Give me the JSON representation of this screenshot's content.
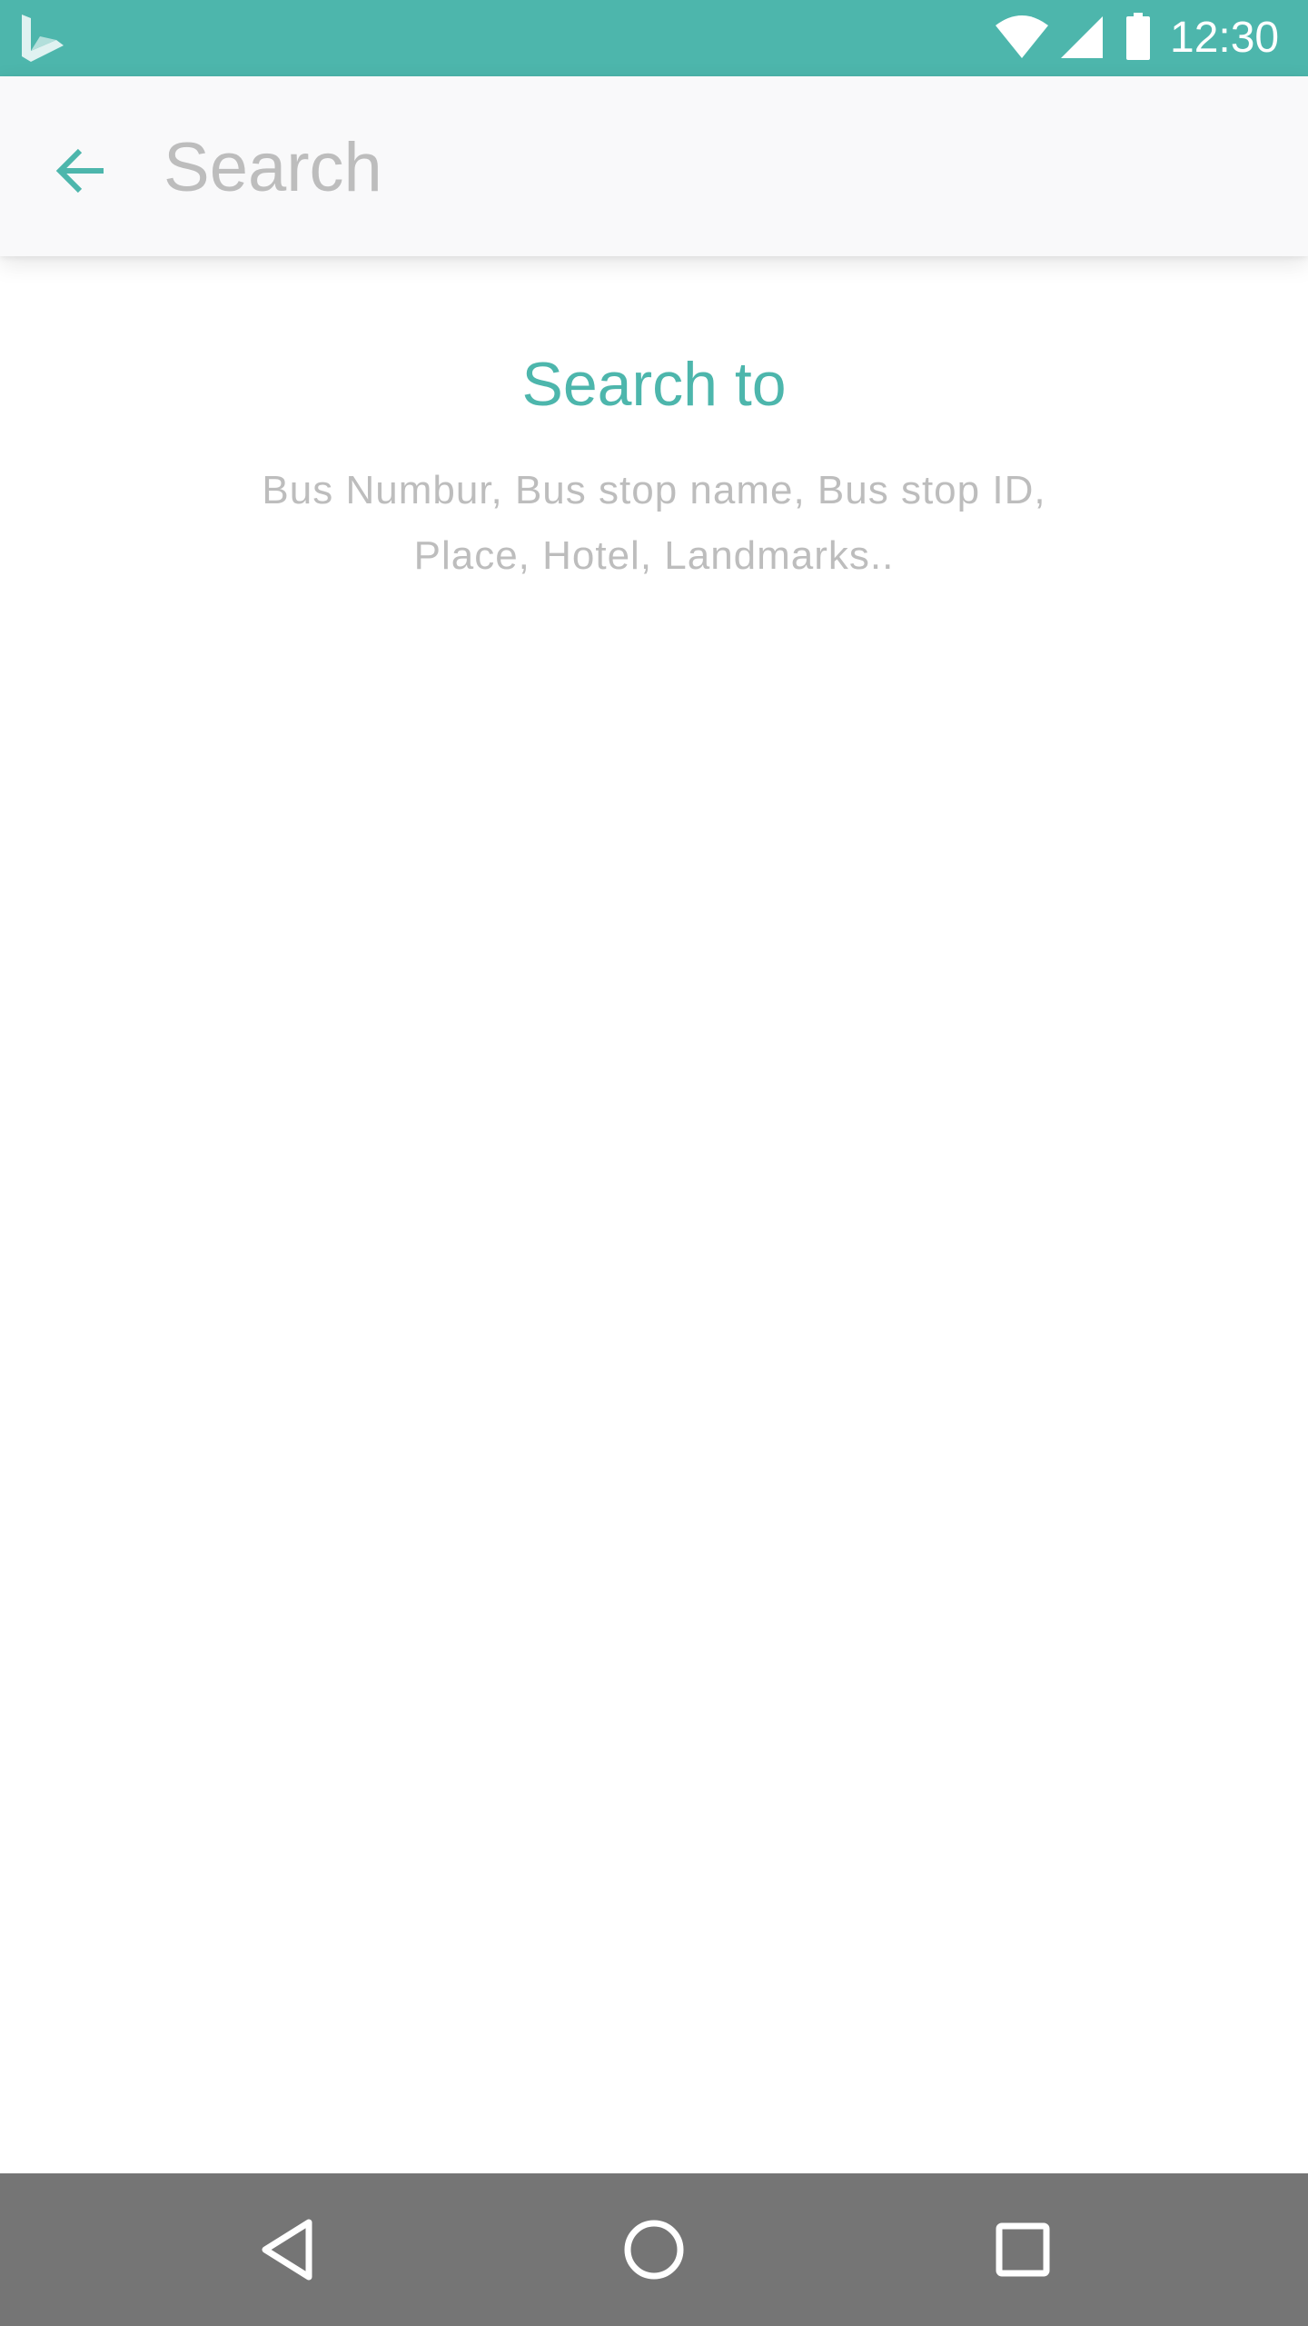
{
  "status_bar": {
    "time": "12:30",
    "icons": [
      "app-logo-icon",
      "wifi-icon",
      "signal-icon",
      "battery-icon"
    ],
    "background_color": "#4db6ac"
  },
  "toolbar": {
    "back_icon": "arrow-back-icon",
    "search": {
      "placeholder": "Search",
      "value": ""
    }
  },
  "content": {
    "title": "Search to",
    "hint": "Bus Numbur, Bus stop name, Bus stop ID, Place, Hotel, Landmarks.."
  },
  "nav_bar": {
    "icons": [
      "nav-back-icon",
      "nav-home-icon",
      "nav-recents-icon"
    ],
    "background_color": "#757575"
  },
  "colors": {
    "accent": "#4db6ac",
    "hint_text": "#bdbdbd",
    "toolbar_bg": "#f9f9fa"
  }
}
